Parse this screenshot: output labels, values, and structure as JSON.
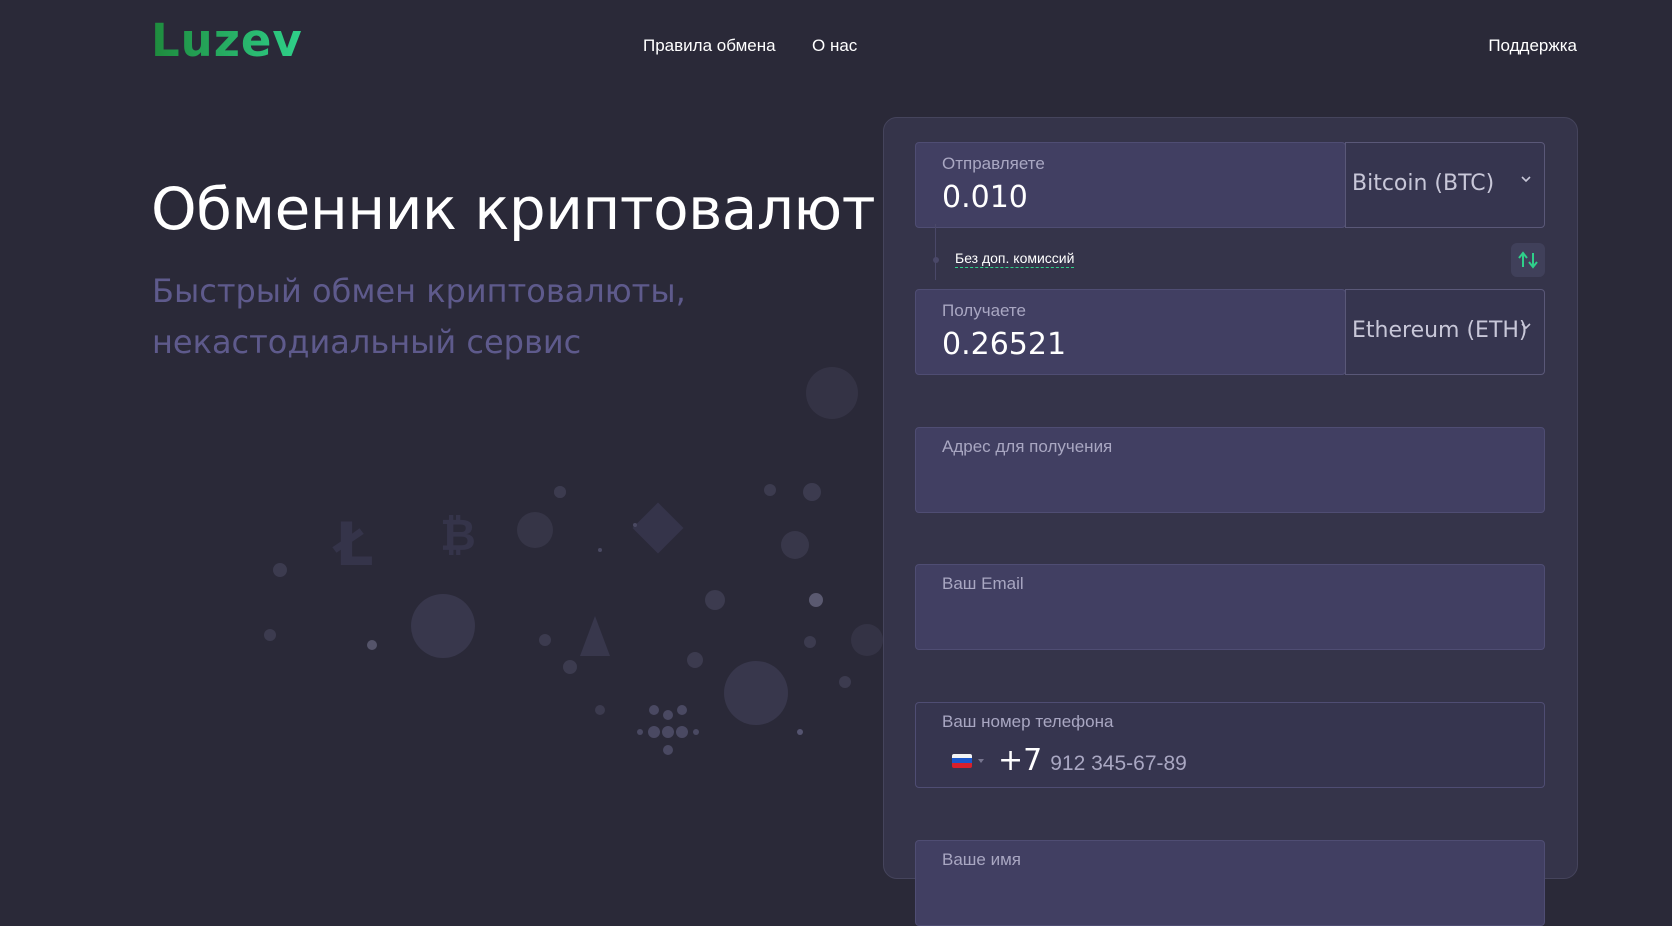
{
  "header": {
    "logo": "Luzev",
    "nav": [
      "Правила обмена",
      "О нас"
    ],
    "support": "Поддержка"
  },
  "hero": {
    "title": "Обменник криптовалют",
    "subtitle": "Быстрый обмен криптовалюты, некастодиальный сервис"
  },
  "exchange": {
    "send_label": "Отправляете",
    "send_value": "0.010",
    "send_currency": "Bitcoin (BTC)",
    "fee_note": "Без доп. комиссий",
    "receive_label": "Получаете",
    "receive_value": "0.26521",
    "receive_currency": "Ethereum (ETH)",
    "address_label": "Адрес для получения",
    "email_label": "Ваш Email",
    "phone_label": "Ваш номер телефона",
    "phone_code": "+7",
    "phone_placeholder": "912 345-67-89",
    "name_label": "Ваше имя"
  },
  "colors": {
    "background": "#2a2938",
    "panel": "#35344a",
    "field": "#413f62",
    "accent": "#2fd08a",
    "subtitle": "#5e5a8c"
  },
  "icons": [
    "chevron-down-icon",
    "swap-arrows-icon",
    "russia-flag-icon",
    "crypto-coins-decoration"
  ]
}
